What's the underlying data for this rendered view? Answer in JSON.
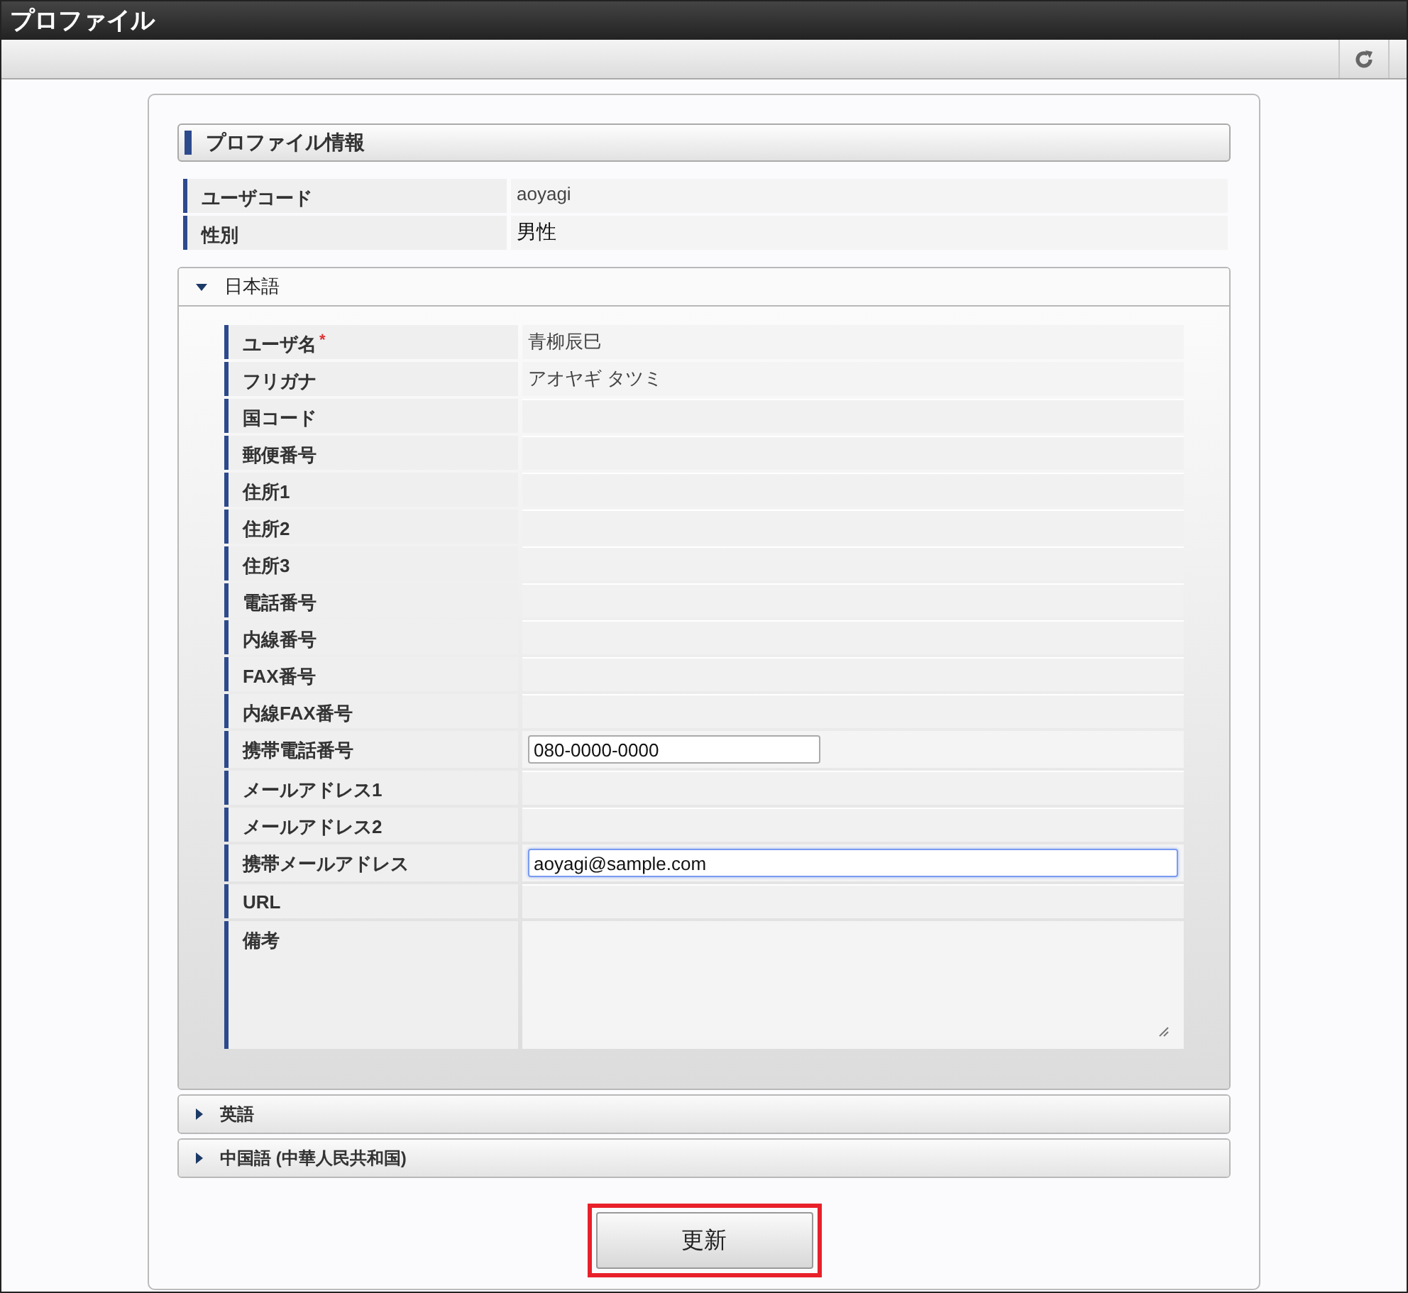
{
  "window": {
    "title": "プロファイル"
  },
  "section": {
    "title": "プロファイル情報"
  },
  "info": [
    {
      "label": "ユーザコード",
      "value": "aoyagi"
    },
    {
      "label": "性別",
      "value": "男性"
    }
  ],
  "languages": [
    {
      "label": "日本語",
      "expanded": true,
      "fields": [
        {
          "label": "ユーザ名",
          "required_mark": "*",
          "kind": "text",
          "value": "青柳辰巳"
        },
        {
          "label": "フリガナ",
          "kind": "text",
          "value": "アオヤギ タツミ"
        },
        {
          "label": "国コード",
          "kind": "text"
        },
        {
          "label": "郵便番号",
          "kind": "text"
        },
        {
          "label": "住所1",
          "kind": "text"
        },
        {
          "label": "住所2",
          "kind": "text"
        },
        {
          "label": "住所3",
          "kind": "text"
        },
        {
          "label": "電話番号",
          "kind": "text"
        },
        {
          "label": "内線番号",
          "kind": "text"
        },
        {
          "label": "FAX番号",
          "kind": "text"
        },
        {
          "label": "内線FAX番号",
          "kind": "text"
        },
        {
          "label": "携帯電話番号",
          "kind": "short-input",
          "value": "080-0000-0000",
          "focused": false
        },
        {
          "label": "メールアドレス1",
          "kind": "text"
        },
        {
          "label": "メールアドレス2",
          "kind": "text"
        },
        {
          "label": "携帯メールアドレス",
          "kind": "wide-input",
          "value": "aoyagi@sample.com",
          "focused": true
        },
        {
          "label": "URL",
          "kind": "text"
        },
        {
          "label": "備考",
          "kind": "textarea"
        }
      ]
    },
    {
      "label": "英語",
      "expanded": false
    },
    {
      "label": "中国語 (中華人民共和国)",
      "expanded": false
    }
  ],
  "submit": {
    "label": "更新",
    "highlighted": true
  }
}
